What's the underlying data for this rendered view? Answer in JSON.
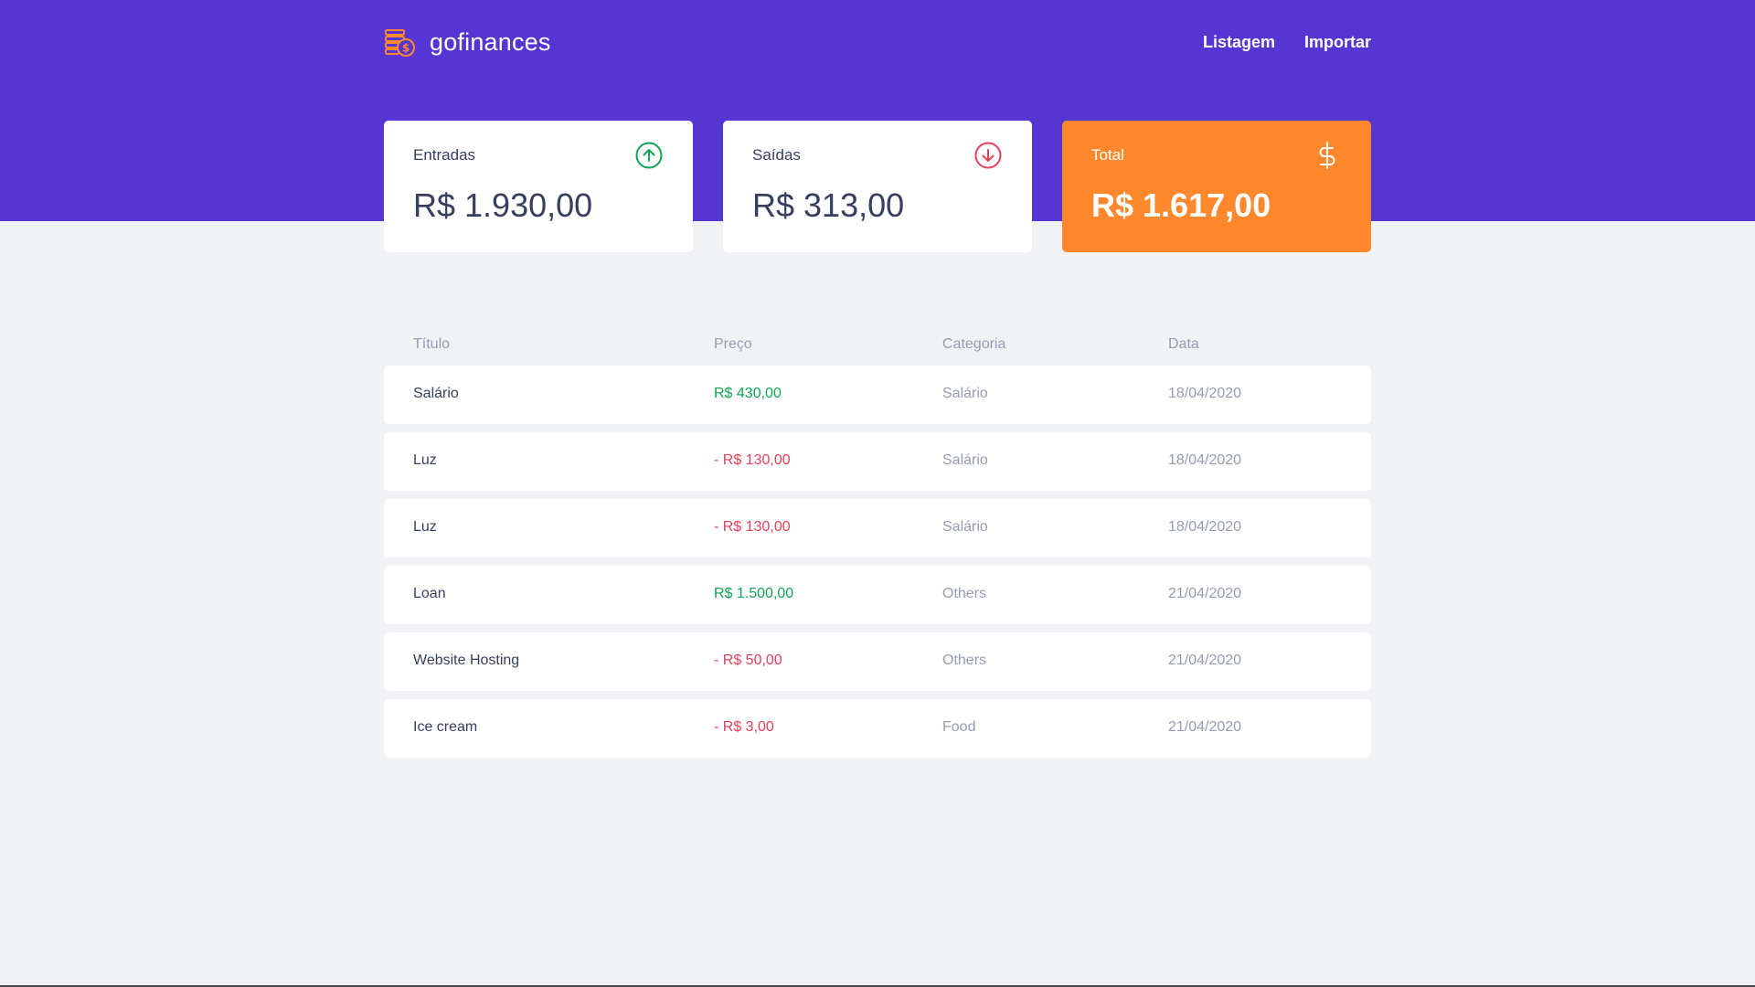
{
  "brand": {
    "name": "gofinances"
  },
  "nav": {
    "items": [
      "Listagem",
      "Importar"
    ]
  },
  "cards": {
    "income": {
      "title": "Entradas",
      "value": "R$ 1.930,00",
      "icon": "arrow-up-circle-icon"
    },
    "outcome": {
      "title": "Saídas",
      "value": "R$ 313,00",
      "icon": "arrow-down-circle-icon"
    },
    "total": {
      "title": "Total",
      "value": "R$ 1.617,00",
      "icon": "dollar-sign-icon"
    }
  },
  "table": {
    "headers": [
      "Título",
      "Preço",
      "Categoria",
      "Data"
    ],
    "rows": [
      {
        "title": "Salário",
        "price": "R$ 430,00",
        "type": "income",
        "category": "Salário",
        "date": "18/04/2020"
      },
      {
        "title": "Luz",
        "price": "- R$ 130,00",
        "type": "outcome",
        "category": "Salário",
        "date": "18/04/2020"
      },
      {
        "title": "Luz",
        "price": "- R$ 130,00",
        "type": "outcome",
        "category": "Salário",
        "date": "18/04/2020"
      },
      {
        "title": "Loan",
        "price": "R$ 1.500,00",
        "type": "income",
        "category": "Others",
        "date": "21/04/2020"
      },
      {
        "title": "Website Hosting",
        "price": "- R$ 50,00",
        "type": "outcome",
        "category": "Others",
        "date": "21/04/2020"
      },
      {
        "title": "Ice cream",
        "price": "- R$ 3,00",
        "type": "outcome",
        "category": "Food",
        "date": "21/04/2020"
      }
    ]
  },
  "colors": {
    "header": "#5636d3",
    "background": "#f0f2f5",
    "total_card": "#ff872c",
    "income": "#12a454",
    "outcome": "#e83f5b",
    "text_dark": "#363f5f",
    "text_muted": "#969cb3"
  }
}
